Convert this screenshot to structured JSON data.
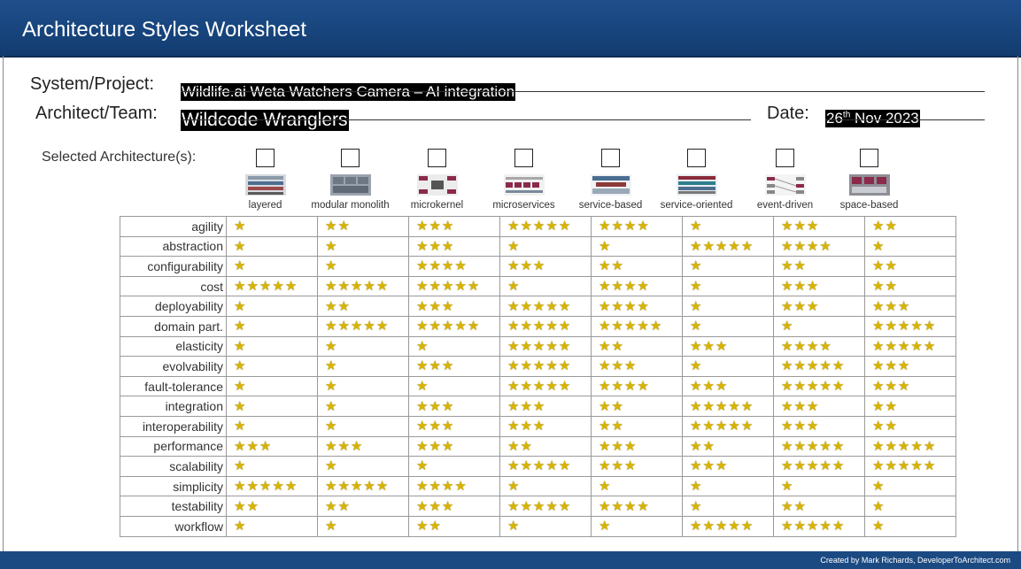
{
  "header": {
    "title": "Architecture Styles Worksheet"
  },
  "form": {
    "system_label": "System/Project:",
    "system_value": "Wildlife.ai Weta Watchers Camera – AI integration",
    "architect_label": "Architect/Team:",
    "architect_value": "Wildcode Wranglers",
    "date_label": "Date:",
    "date_day": "26",
    "date_suffix": "th",
    "date_rest": " Nov 2023",
    "selected_label": "Selected Architecture(s):"
  },
  "styles": [
    "layered",
    "modular monolith",
    "microkernel",
    "microservices",
    "service-based",
    "service-oriented",
    "event-driven",
    "space-based"
  ],
  "characteristics": [
    "agility",
    "abstraction",
    "configurability",
    "cost",
    "deployability",
    "domain part.",
    "elasticity",
    "evolvability",
    "fault-tolerance",
    "integration",
    "interoperability",
    "performance",
    "scalability",
    "simplicity",
    "testability",
    "workflow"
  ],
  "ratings": [
    [
      1,
      2,
      3,
      5,
      4,
      1,
      3,
      2
    ],
    [
      1,
      1,
      3,
      1,
      1,
      5,
      4,
      1
    ],
    [
      1,
      1,
      4,
      3,
      2,
      1,
      2,
      2
    ],
    [
      5,
      5,
      5,
      1,
      4,
      1,
      3,
      2
    ],
    [
      1,
      2,
      3,
      5,
      4,
      1,
      3,
      3
    ],
    [
      1,
      5,
      5,
      5,
      5,
      1,
      1,
      5
    ],
    [
      1,
      1,
      1,
      5,
      2,
      3,
      4,
      5
    ],
    [
      1,
      1,
      3,
      5,
      3,
      1,
      5,
      3
    ],
    [
      1,
      1,
      1,
      5,
      4,
      3,
      5,
      3
    ],
    [
      1,
      1,
      3,
      3,
      2,
      5,
      3,
      2
    ],
    [
      1,
      1,
      3,
      3,
      2,
      5,
      3,
      2
    ],
    [
      3,
      3,
      3,
      2,
      3,
      2,
      5,
      5
    ],
    [
      1,
      1,
      1,
      5,
      3,
      3,
      5,
      5
    ],
    [
      5,
      5,
      4,
      1,
      1,
      1,
      1,
      1
    ],
    [
      2,
      2,
      3,
      5,
      4,
      1,
      2,
      1
    ],
    [
      1,
      1,
      2,
      1,
      1,
      5,
      5,
      1
    ]
  ],
  "icons": {
    "star": "star-icon"
  },
  "footer": {
    "credit": "Created by Mark Richards, DeveloperToArchitect.com"
  },
  "colors": {
    "title_bar": "#1f4f8c",
    "star": "#d8b400",
    "footer": "#1b4a82"
  }
}
